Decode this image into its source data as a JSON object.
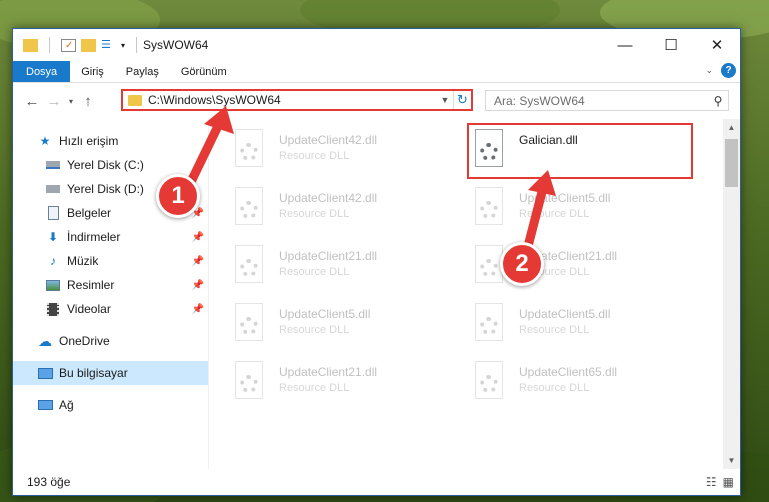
{
  "window": {
    "title": "SysWOW64"
  },
  "ribbon": {
    "tabs": [
      "Dosya",
      "Giriş",
      "Paylaş",
      "Görünüm"
    ]
  },
  "address": {
    "path": "C:\\Windows\\SysWOW64"
  },
  "search": {
    "placeholder": "Ara: SysWOW64"
  },
  "sidebar": {
    "items": [
      {
        "label": "Hızlı erişim"
      },
      {
        "label": "Yerel Disk (C:)"
      },
      {
        "label": "Yerel Disk (D:)"
      },
      {
        "label": "Belgeler"
      },
      {
        "label": "İndirmeler"
      },
      {
        "label": "Müzik"
      },
      {
        "label": "Resimler"
      },
      {
        "label": "Videolar"
      },
      {
        "label": "OneDrive"
      },
      {
        "label": "Bu bilgisayar"
      },
      {
        "label": "Ağ"
      }
    ]
  },
  "files": [
    {
      "name": "UpdateClient42.dll",
      "type": "Resource DLL"
    },
    {
      "name": "Galician.dll",
      "type": ""
    },
    {
      "name": "UpdateClient42.dll",
      "type": "Resource DLL"
    },
    {
      "name": "UpdateClient5.dll",
      "type": "Resource DLL"
    },
    {
      "name": "UpdateClient21.dll",
      "type": "Resource DLL"
    },
    {
      "name": "UpdateClient21.dll",
      "type": "Resource DLL"
    },
    {
      "name": "UpdateClient5.dll",
      "type": "Resource DLL"
    },
    {
      "name": "UpdateClient5.dll",
      "type": "Resource DLL"
    },
    {
      "name": "UpdateClient21.dll",
      "type": "Resource DLL"
    },
    {
      "name": "UpdateClient65.dll",
      "type": "Resource DLL"
    }
  ],
  "status": {
    "count": "193 öğe"
  },
  "annotations": {
    "step1": "1",
    "step2": "2"
  },
  "colors": {
    "accent": "#1979ca",
    "highlight": "#e53935",
    "selected": "#cce8ff"
  }
}
